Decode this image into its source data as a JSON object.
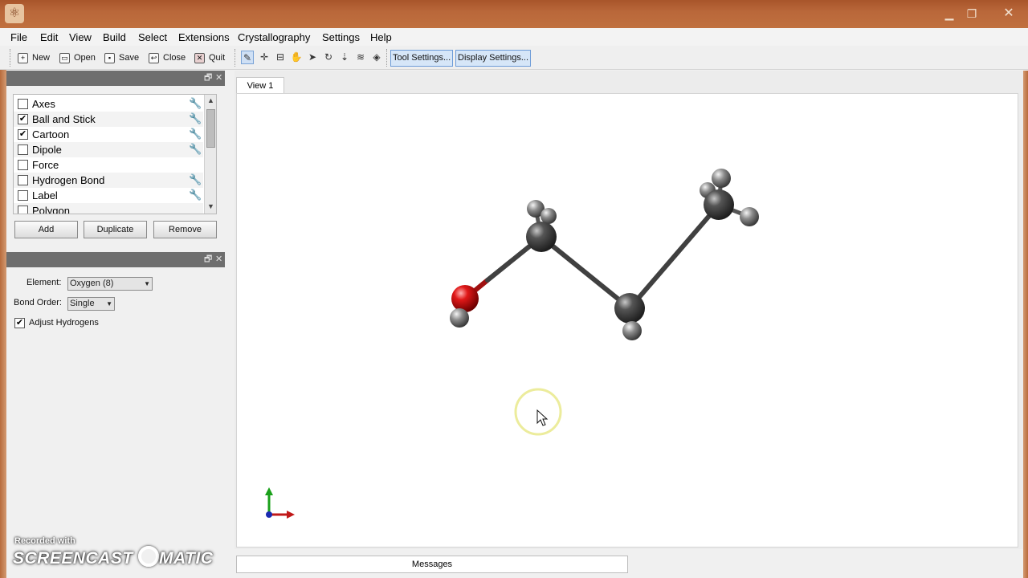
{
  "menu": [
    "File",
    "Edit",
    "View",
    "Build",
    "Select",
    "Extensions",
    "Crystallography",
    "Settings",
    "Help"
  ],
  "toolbar": {
    "new_label": "New",
    "open_label": "Open",
    "save_label": "Save",
    "close_label": "Close",
    "quit_label": "Quit",
    "tool_settings_label": "Tool Settings...",
    "display_settings_label": "Display Settings..."
  },
  "display_types": {
    "items": [
      {
        "label": "Axes",
        "checked": false,
        "has_settings": true
      },
      {
        "label": "Ball and Stick",
        "checked": true,
        "has_settings": true
      },
      {
        "label": "Cartoon",
        "checked": true,
        "has_settings": true
      },
      {
        "label": "Dipole",
        "checked": false,
        "has_settings": true
      },
      {
        "label": "Force",
        "checked": false,
        "has_settings": false
      },
      {
        "label": "Hydrogen Bond",
        "checked": false,
        "has_settings": true
      },
      {
        "label": "Label",
        "checked": false,
        "has_settings": true
      },
      {
        "label": "Polygon",
        "checked": false,
        "has_settings": false
      }
    ],
    "add_label": "Add",
    "duplicate_label": "Duplicate",
    "remove_label": "Remove"
  },
  "draw_settings": {
    "element_label": "Element:",
    "element_value": "Oxygen (8)",
    "bond_order_label": "Bond Order:",
    "bond_order_value": "Single",
    "adjust_hydrogens_label": "Adjust Hydrogens",
    "adjust_hydrogens_checked": true
  },
  "view": {
    "tab_label": "View 1"
  },
  "messages_label": "Messages",
  "watermark": {
    "top": "Recorded with",
    "brand": "SCREENCAST",
    "brand_suffix": "MATIC"
  },
  "colors": {
    "carbon": "#3c3c3c",
    "hydrogen": "#7a7a7a",
    "oxygen": "#d91515",
    "cursor_highlight": "#ecec9c"
  }
}
